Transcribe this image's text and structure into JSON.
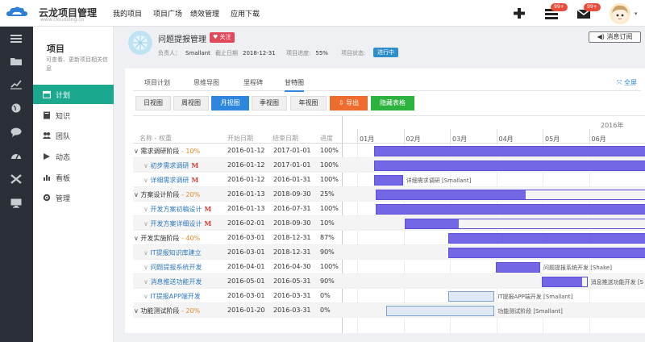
{
  "app": {
    "name": "云龙项目管理",
    "domain": "www.cloudlong.cn"
  },
  "topnav": [
    "我的项目",
    "项目广场",
    "绩效管理",
    "应用下载"
  ],
  "topicons": {
    "add": "plus-icon",
    "tasks_badge": "99+",
    "mail_badge": "99+"
  },
  "sidebar": {
    "title": "项目",
    "desc": "可查看、更新项目相关信息",
    "items": [
      {
        "label": "计划",
        "icon": "calendar-icon",
        "active": true
      },
      {
        "label": "知识",
        "icon": "book-icon"
      },
      {
        "label": "团队",
        "icon": "team-icon"
      },
      {
        "label": "动态",
        "icon": "activity-icon"
      },
      {
        "label": "看板",
        "icon": "chart-icon"
      },
      {
        "label": "管理",
        "icon": "gear-icon"
      }
    ]
  },
  "project": {
    "name": "问题提报管理",
    "follow": "关注",
    "owner_label": "负责人：",
    "owner": "Smallant",
    "due_label": "截止日期",
    "due": "2018-12-31",
    "progress_label": "项目进度:",
    "progress": "55%",
    "status_label": "项目状态:",
    "status": "进行中",
    "subscribe": "消息订阅"
  },
  "tabs": [
    "项目计划",
    "思维导图",
    "里程碑",
    "甘特图"
  ],
  "fullscreen": "全屏",
  "views": [
    "日视图",
    "周视图",
    "月视图",
    "季视图",
    "年视图"
  ],
  "export": "导出",
  "hide_table": "隐藏表格",
  "gantt": {
    "columns": [
      "名称 - 权重",
      "开始日期",
      "结束日期",
      "进度"
    ],
    "year": "2016年",
    "months": [
      "01月",
      "02月",
      "03月",
      "04月",
      "05月",
      "06月"
    ],
    "rows": [
      {
        "name": "需求调研阶段",
        "weight": "10%",
        "start": "2016-01-12",
        "end": "2017-01-01",
        "progress": "100%",
        "level": 0
      },
      {
        "name": "初步需求调研",
        "mark": "M",
        "start": "2016-01-12",
        "end": "2017-01-01",
        "progress": "100%",
        "level": 1
      },
      {
        "name": "详细需求调研",
        "mark": "M",
        "start": "2016-01-12",
        "end": "2016-01-31",
        "progress": "100%",
        "level": 1,
        "bar_label": "详细需求调研 [Smallant]"
      },
      {
        "name": "方案设计阶段",
        "weight": "20%",
        "start": "2016-01-13",
        "end": "2018-09-30",
        "progress": "25%",
        "level": 0
      },
      {
        "name": "开发方案初稿设计",
        "mark": "M",
        "start": "2016-01-13",
        "end": "2016-07-31",
        "progress": "100%",
        "level": 1
      },
      {
        "name": "开发方案详细设计",
        "mark": "M",
        "start": "2016-02-01",
        "end": "2018-09-30",
        "progress": "10%",
        "level": 1
      },
      {
        "name": "开发实施阶段",
        "weight": "40%",
        "start": "2016-03-01",
        "end": "2018-12-31",
        "progress": "87%",
        "level": 0
      },
      {
        "name": "IT提报知识库建立",
        "start": "2016-03-01",
        "end": "2018-12-31",
        "progress": "90%",
        "level": 1
      },
      {
        "name": "问题提报系统开发",
        "start": "2016-04-01",
        "end": "2016-04-30",
        "progress": "100%",
        "level": 1,
        "bar_label": "问题提报系统开发 [Shake]"
      },
      {
        "name": "消息推送功能开发",
        "start": "2016-05-01",
        "end": "2016-05-31",
        "progress": "90%",
        "level": 1,
        "bar_label": "消息推送功能开发 [S"
      },
      {
        "name": "IT提报APP端开发",
        "start": "2016-03-01",
        "end": "2016-03-31",
        "progress": "0%",
        "level": 1,
        "bar_label": "IT提报APP端开发 [Smallant]"
      },
      {
        "name": "功能测试阶段",
        "weight": "20%",
        "start": "2016-01-20",
        "end": "2016-03-31",
        "progress": "0%",
        "level": 0,
        "bar_label": "功能测试阶段 [Smallant]"
      }
    ]
  },
  "colors": {
    "accent": "#1aa88e",
    "bar": "#7367e6",
    "primary": "#2e86de",
    "export": "#ee6d2e",
    "hide": "#2cb33e",
    "follow": "#e24a5b"
  }
}
